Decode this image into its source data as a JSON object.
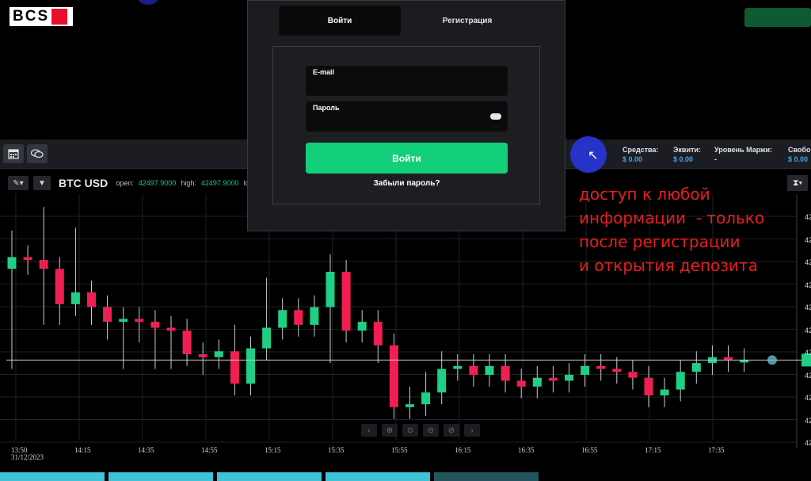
{
  "header": {
    "logo_text": "BCS"
  },
  "toolbar": {
    "account": [
      {
        "label": "Средства:",
        "value": "$ 0.00"
      },
      {
        "label": "Эквити:",
        "value": "$ 0.00"
      },
      {
        "label": "Уровень Маржи:",
        "value": "-"
      },
      {
        "label": "Свобо",
        "value": "$ 0.00"
      }
    ]
  },
  "symbol": {
    "name": "BTC USD",
    "open_label": "open:",
    "open_value": "42497.9000",
    "high_label": "high:",
    "high_value": "42497.9000",
    "low_label": "low:"
  },
  "chart_data": {
    "type": "candlestick",
    "x_labels": [
      "13:50",
      "14:15",
      "14:35",
      "14:55",
      "15:15",
      "15:35",
      "15:55",
      "16:15",
      "16:35",
      "16:55",
      "17:15",
      "17:35"
    ],
    "x_date": "31/12/2023",
    "y_labels": [
      "42",
      "42",
      "42",
      "42",
      "42",
      "42",
      "42",
      "42",
      "42",
      "42",
      "42"
    ],
    "colors": {
      "up": "#1fcf86",
      "down": "#f01f52",
      "grid": "#1e2126",
      "crosshair": "#c9ccd2"
    },
    "candles": [
      [
        30,
        34,
        0,
        39
      ],
      [
        34,
        33,
        32,
        34
      ],
      [
        33,
        30,
        15,
        47
      ],
      [
        30,
        18,
        15,
        18
      ],
      [
        18,
        22,
        22,
        40
      ],
      [
        22,
        17,
        15,
        17
      ],
      [
        17,
        12,
        10,
        12
      ],
      [
        12,
        13,
        0,
        13
      ],
      [
        13,
        12,
        13,
        9
      ],
      [
        12,
        10,
        0,
        10
      ],
      [
        10,
        9,
        0,
        9
      ],
      [
        9,
        1,
        8,
        1
      ],
      [
        1,
        0,
        -2,
        -2
      ],
      [
        0,
        2,
        0,
        2
      ],
      [
        2,
        -9,
        7,
        -9
      ],
      [
        -9,
        3,
        3,
        3
      ],
      [
        3,
        10,
        10,
        23
      ],
      [
        10,
        16,
        14,
        14
      ],
      [
        16,
        11,
        12,
        11
      ],
      [
        11,
        17,
        15,
        17
      ],
      [
        17,
        29,
        2,
        31
      ],
      [
        29,
        9,
        9,
        9
      ],
      [
        9,
        12,
        12,
        11
      ],
      [
        12,
        4,
        4,
        2
      ],
      [
        4,
        -17,
        -17,
        -17
      ],
      [
        -17,
        -16,
        -14,
        -14
      ],
      [
        -16,
        -12,
        -9,
        -9
      ],
      [
        -12,
        -4,
        -2,
        -2
      ],
      [
        -4,
        -3,
        -3,
        -3
      ],
      [
        -3,
        -6,
        -6,
        -6
      ],
      [
        -6,
        -3,
        -3,
        -3
      ],
      [
        -3,
        -8,
        -8,
        -8
      ],
      [
        -8,
        -10,
        -10,
        -10
      ],
      [
        -10,
        -7,
        -7,
        -7
      ],
      [
        -7,
        -8,
        -8,
        -8
      ],
      [
        -8,
        -6,
        -6,
        -6
      ],
      [
        -6,
        -3,
        -3,
        -3
      ],
      [
        -3,
        -4,
        -4,
        -4
      ],
      [
        -4,
        -5,
        -5,
        -5
      ],
      [
        -5,
        -7,
        -7,
        -7
      ],
      [
        -7,
        -13,
        -13,
        -13
      ],
      [
        -13,
        -11,
        -11,
        -11
      ],
      [
        -11,
        -5,
        -5,
        -5
      ],
      [
        -5,
        -2,
        -2,
        -2
      ],
      [
        -2,
        0,
        0,
        0
      ],
      [
        0,
        -1,
        -1,
        -1
      ],
      [
        -1,
        -1,
        -1,
        -1
      ]
    ]
  },
  "annotation": {
    "text": "доступ к любой\nинформации  - только\nпосле регистрации\nи открытия депозита"
  },
  "modal": {
    "tab_login": "Войти",
    "tab_register": "Регистрация",
    "email_label": "E-mail",
    "email_value": "",
    "password_label": "Пароль",
    "password_value": "",
    "submit_label": "Войти",
    "forgot_label": "Забыли пароль?"
  }
}
